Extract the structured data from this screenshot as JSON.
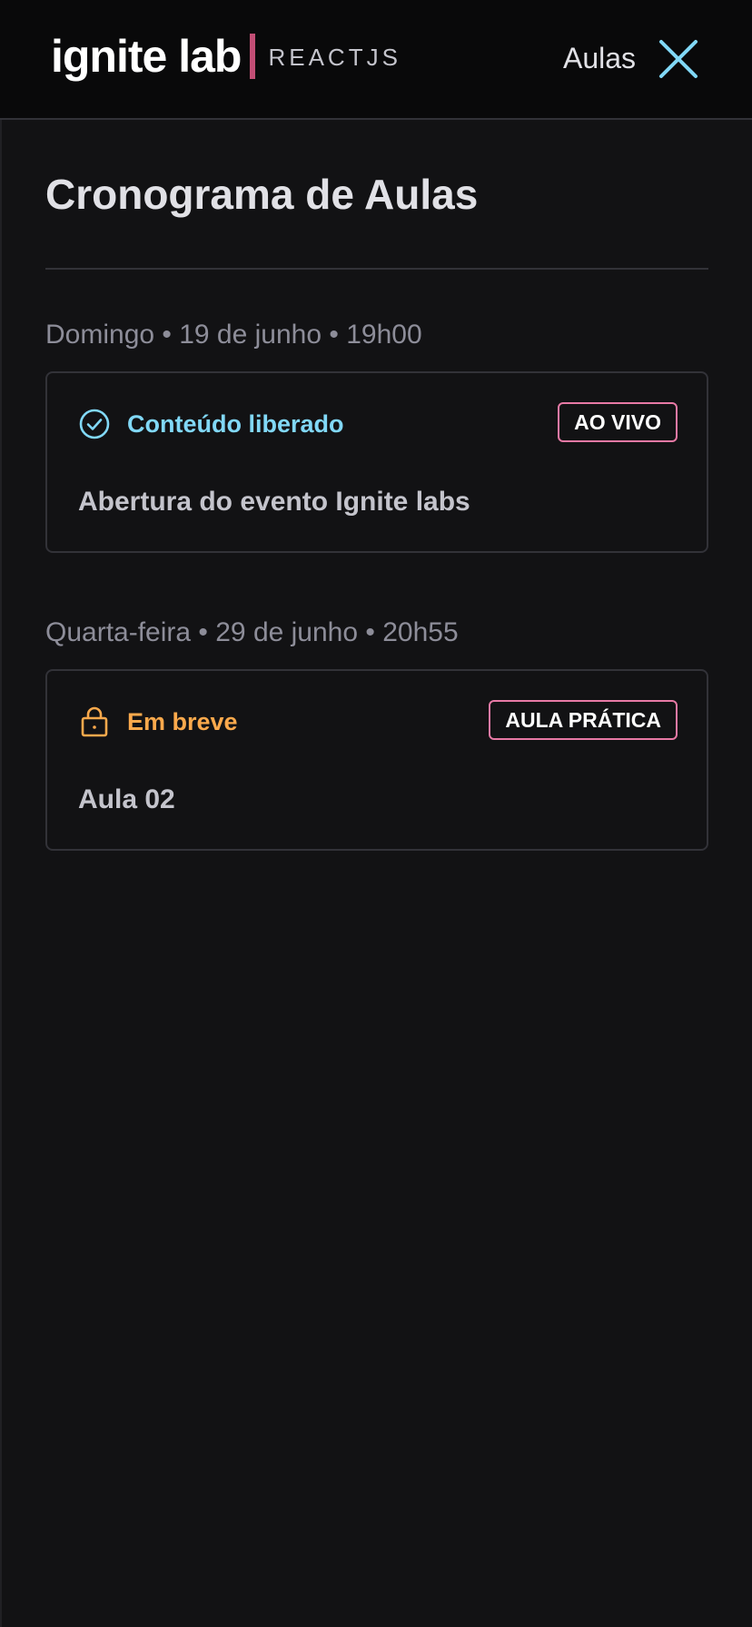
{
  "header": {
    "logo_main": "ignite lab",
    "logo_sub": "REACTJS",
    "nav_label": "Aulas",
    "close_icon": "close-icon"
  },
  "main": {
    "title": "Cronograma de Aulas",
    "lessons": [
      {
        "date": "Domingo • 19 de junho • 19h00",
        "status": "Conteúdo liberado",
        "status_icon": "check-circle-icon",
        "badge": "AO VIVO",
        "title": "Abertura do evento Ignite labs"
      },
      {
        "date": "Quarta-feira • 29 de junho • 20h55",
        "status": "Em breve",
        "status_icon": "lock-icon",
        "badge": "AULA PRÁTICA",
        "title": "Aula 02"
      }
    ]
  },
  "colors": {
    "background": "#121214",
    "header_background": "#09090a",
    "available": "#81d8f7",
    "soon": "#fba94c",
    "badge_border": "#e779a5",
    "logo_bar": "#c24e75"
  }
}
